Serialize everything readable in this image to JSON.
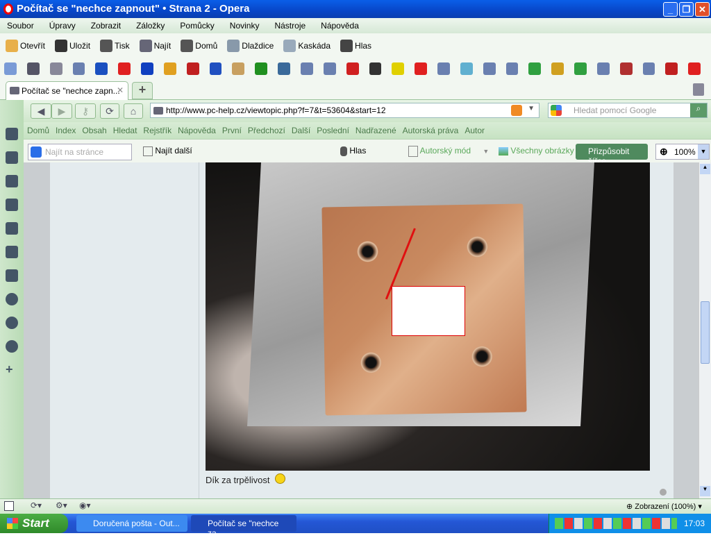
{
  "window": {
    "title": "Počítač se \"nechce zapnout\" • Strana 2 - Opera",
    "min": "_",
    "max": "❐",
    "close": "✕"
  },
  "menu": [
    "Soubor",
    "Úpravy",
    "Zobrazit",
    "Záložky",
    "Pomůcky",
    "Novinky",
    "Nástroje",
    "Nápověda"
  ],
  "toolbar": [
    {
      "label": "Otevřít",
      "icon": "folder-icon",
      "color": "#e8b04a"
    },
    {
      "label": "Uložit",
      "icon": "floppy-icon",
      "color": "#333"
    },
    {
      "label": "Tisk",
      "icon": "printer-icon",
      "color": "#555"
    },
    {
      "label": "Najít",
      "icon": "magnifier-icon",
      "color": "#667"
    },
    {
      "label": "Domů",
      "icon": "home-icon",
      "color": "#555"
    },
    {
      "label": "Dlaždice",
      "icon": "tile-icon",
      "color": "#8899aa"
    },
    {
      "label": "Kaskáda",
      "icon": "cascade-icon",
      "color": "#99aabb"
    },
    {
      "label": "Hlas",
      "icon": "microphone-icon",
      "color": "#444"
    }
  ],
  "bookmark_colors": [
    "#7a9bd6",
    "#556",
    "#889",
    "#6a80b0",
    "#1a50c0",
    "#e02020",
    "#1040c0",
    "#e0a020",
    "#c02020",
    "#2050c0",
    "#c8a060",
    "#209020",
    "#3a6a9a",
    "#6a80b0",
    "#6a80b0",
    "#d02020",
    "#333",
    "#e0d000",
    "#e02020",
    "#6a80b0",
    "#60b0d0",
    "#6a80b0",
    "#6a80b0",
    "#30a040",
    "#d0a020",
    "#30a040",
    "#6a80b0",
    "#b03030",
    "#6a80b0",
    "#c02020",
    "#e02020"
  ],
  "tab": {
    "label": "Počítač se \"nechce zapn...",
    "close": "✕",
    "new": "+"
  },
  "address": {
    "url": "http://www.pc-help.cz/viewtopic.php?f=7&t=53604&start=12",
    "search_placeholder": "Hledat pomocí Google"
  },
  "nav_links": [
    "Domů",
    "Index",
    "Obsah",
    "Hledat",
    "Rejstřík",
    "Nápověda",
    "První",
    "Předchozí",
    "Další",
    "Poslední",
    "Nadřazené",
    "Autorská práva",
    "Autor"
  ],
  "findbar": {
    "placeholder": "Najít na stránce",
    "find_next": "Najít další",
    "voice": "Hlas",
    "author_mode": "Autorský mód",
    "all_images": "Všechny obrázky",
    "fit_width": "Přizpůsobit šířce",
    "zoom": "100%"
  },
  "post": {
    "caption": "Dík za trpělivost"
  },
  "statusbar": {
    "zoom": "Zobrazení (100%)"
  },
  "taskbar": {
    "start": "Start",
    "tasks": [
      "Doručená pošta - Out...",
      "Počítač se \"nechce za..."
    ],
    "clock": "17:03"
  }
}
